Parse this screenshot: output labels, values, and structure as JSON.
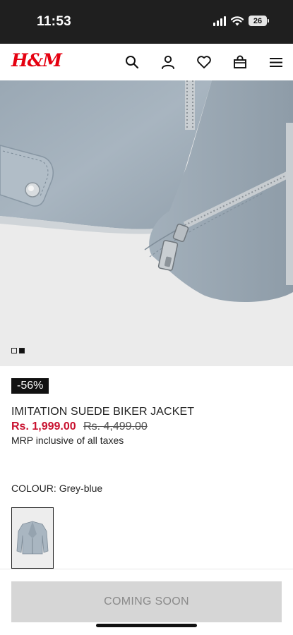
{
  "status_bar": {
    "time": "11:53",
    "battery": "26",
    "icons": [
      "signal-icon",
      "wifi-icon",
      "battery-icon"
    ]
  },
  "header": {
    "logo": "H&M",
    "brand_color": "#e50010",
    "icons": [
      "search-icon",
      "account-icon",
      "favourites-icon",
      "shopping-bag-icon",
      "menu-icon"
    ]
  },
  "gallery": {
    "image": "suede-jacket-zip-closeup",
    "slides": 2,
    "active_index": 1
  },
  "product": {
    "discount": "-56%",
    "name": "IMITATION SUEDE BIKER JACKET",
    "sale_price": "Rs. 1,999.00",
    "original_price": "Rs. 4,499.00",
    "tax_note": "MRP inclusive of all taxes",
    "sale_color": "#c8102e"
  },
  "colour": {
    "label": "COLOUR:",
    "value": "Grey-blue",
    "swatch_color": "#a9b6c1"
  },
  "cta": {
    "label": "COMING SOON"
  }
}
